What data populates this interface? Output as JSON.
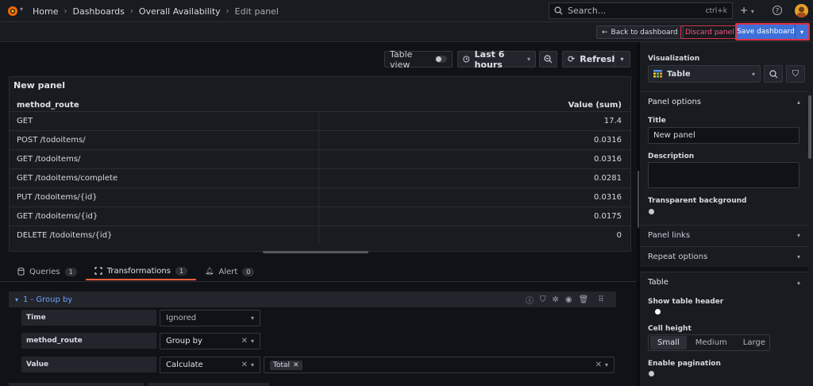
{
  "topbar": {
    "breadcrumb": [
      "Home",
      "Dashboards",
      "Overall Availability",
      "Edit panel"
    ],
    "search_placeholder": "Search...",
    "search_shortcut": "ctrl+k"
  },
  "actions": {
    "back_label": "Back to dashboard",
    "discard_label": "Discard panel",
    "save_label": "Save dashboard"
  },
  "toolbar": {
    "table_view_label": "Table view",
    "table_view_on": false,
    "time_range": "Last 6 hours",
    "refresh_label": "Refresh"
  },
  "panel": {
    "title": "New panel",
    "columns": [
      "method_route",
      "Value (sum)"
    ],
    "rows": [
      {
        "route": "GET",
        "value": "17.4"
      },
      {
        "route": "POST /todoitems/",
        "value": "0.0316"
      },
      {
        "route": "GET /todoitems/",
        "value": "0.0316"
      },
      {
        "route": "GET /todoitems/complete",
        "value": "0.0281"
      },
      {
        "route": "PUT /todoitems/{id}",
        "value": "0.0316"
      },
      {
        "route": "GET /todoitems/{id}",
        "value": "0.0175"
      },
      {
        "route": "DELETE /todoitems/{id}",
        "value": "0"
      }
    ]
  },
  "tabs": [
    {
      "label": "Queries",
      "count": "1"
    },
    {
      "label": "Transformations",
      "count": "1"
    },
    {
      "label": "Alert",
      "count": "0"
    }
  ],
  "transform": {
    "header": "1 - Group by",
    "fields": [
      {
        "name": "Time",
        "mode": "Ignored"
      },
      {
        "name": "method_route",
        "mode": "Group by"
      },
      {
        "name": "Value",
        "mode": "Calculate",
        "calc": "Total"
      }
    ]
  },
  "options": {
    "visualization_label": "Visualization",
    "visualization": "Table",
    "panel_options_label": "Panel options",
    "title_label": "Title",
    "title_value": "New panel",
    "description_label": "Description",
    "transparent_label": "Transparent background",
    "panel_links_label": "Panel links",
    "repeat_label": "Repeat options",
    "table_label": "Table",
    "show_header_label": "Show table header",
    "cell_height_label": "Cell height",
    "cell_heights": [
      "Small",
      "Medium",
      "Large"
    ],
    "pagination_label": "Enable pagination"
  },
  "colors": {
    "accent_blue": "#3d71d9",
    "danger": "#e02f44",
    "tab_underline": "#f55f3e"
  }
}
